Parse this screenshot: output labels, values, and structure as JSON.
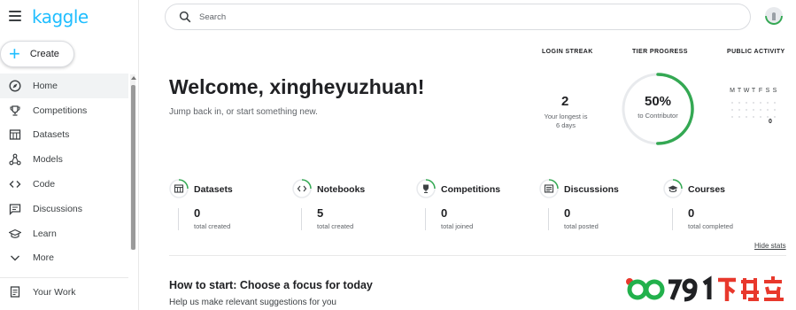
{
  "app": {
    "logo": "kaggle"
  },
  "sidebar": {
    "create_label": "Create",
    "items": [
      {
        "label": "Home",
        "icon": "compass-icon",
        "active": true
      },
      {
        "label": "Competitions",
        "icon": "trophy-icon"
      },
      {
        "label": "Datasets",
        "icon": "table-icon"
      },
      {
        "label": "Models",
        "icon": "models-icon"
      },
      {
        "label": "Code",
        "icon": "code-icon"
      },
      {
        "label": "Discussions",
        "icon": "discussion-icon"
      },
      {
        "label": "Learn",
        "icon": "school-icon"
      },
      {
        "label": "More",
        "icon": "chevron-down-icon"
      }
    ],
    "your_work": "Your Work"
  },
  "search": {
    "placeholder": "Search"
  },
  "welcome": {
    "title": "Welcome, xingheyuzhuan!",
    "subtitle": "Jump back in, or start something new."
  },
  "stats": {
    "login_streak": {
      "header": "LOGIN STREAK",
      "value": "2",
      "sub1": "Your longest is",
      "sub2": "6 days"
    },
    "tier_progress": {
      "header": "TIER PROGRESS",
      "value": "50%",
      "sub": "to Contributor",
      "progress": 0.5
    },
    "public_activity": {
      "header": "PUBLIC ACTIVITY",
      "days": [
        "M",
        "T",
        "W",
        "T",
        "F",
        "S",
        "S"
      ],
      "last_marker": "0"
    }
  },
  "counters": [
    {
      "title": "Datasets",
      "value": "0",
      "sub": "total created",
      "icon": "table-icon"
    },
    {
      "title": "Notebooks",
      "value": "5",
      "sub": "total created",
      "icon": "code-icon"
    },
    {
      "title": "Competitions",
      "value": "0",
      "sub": "total joined",
      "icon": "trophy-icon"
    },
    {
      "title": "Discussions",
      "value": "0",
      "sub": "total posted",
      "icon": "discussion-icon"
    },
    {
      "title": "Courses",
      "value": "0",
      "sub": "total completed",
      "icon": "school-icon"
    }
  ],
  "hide_stats": "Hide stats",
  "how_to_start": {
    "title": "How to start: Choose a focus for today",
    "subtitle": "Help us make relevant suggestions for you"
  },
  "watermark": {
    "text": "0791下载站"
  },
  "colors": {
    "accent": "#20beff",
    "progress": "#34a853",
    "watermark_green": "#22b14c",
    "watermark_red": "#e8382c"
  }
}
